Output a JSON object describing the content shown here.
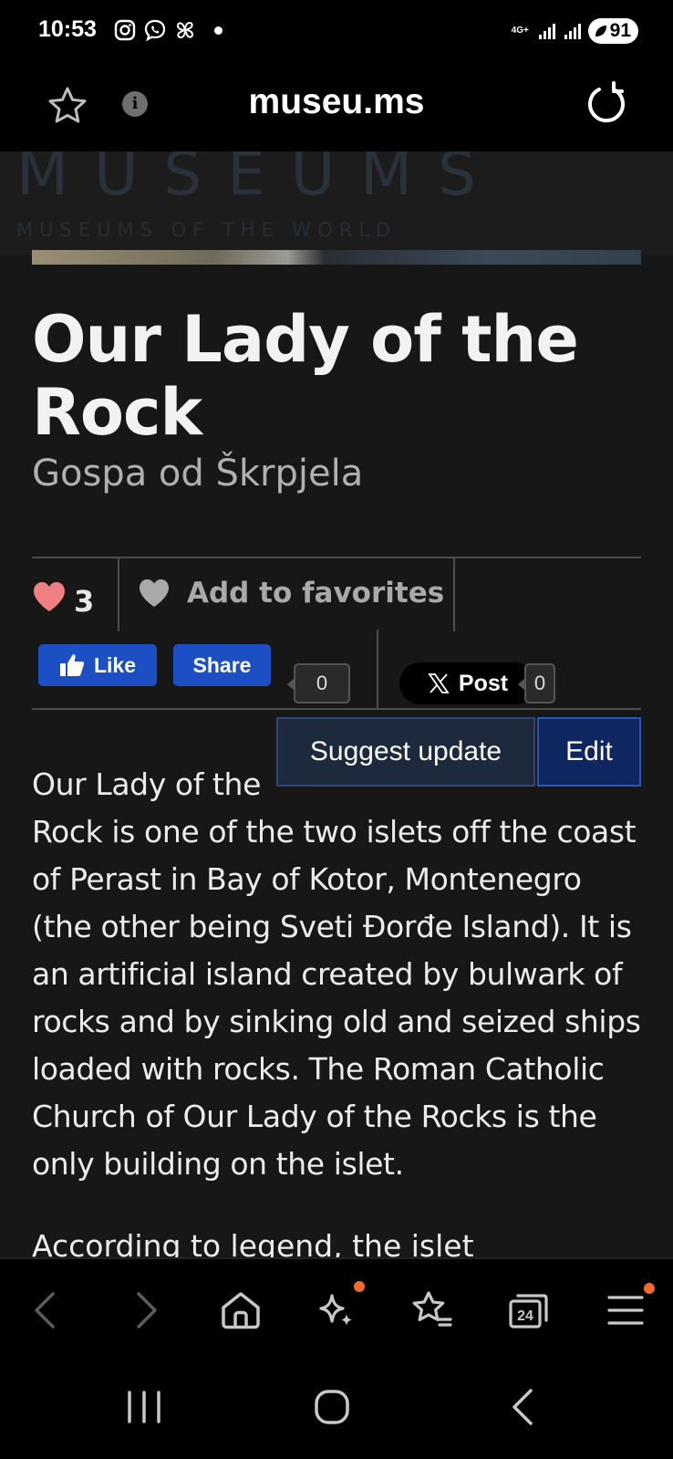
{
  "status": {
    "time": "10:53",
    "network_label": "4G+",
    "battery": "91",
    "left_icons": [
      "instagram-icon",
      "viber-icon",
      "pinwheel-icon",
      "notification-dot"
    ],
    "right_icons": [
      "signal-icon",
      "signal-icon",
      "battery-icon"
    ]
  },
  "browser": {
    "url": "museu.ms"
  },
  "site": {
    "logo_title": "MUSEUMS",
    "logo_subtitle": "MUSEUMS OF THE WORLD"
  },
  "article": {
    "title": "Our Lady of the Rock",
    "subtitle": "Gospa od Škrpjela",
    "likes_count": "3",
    "add_favorites_label": "Add to favorites",
    "fb_like_label": "Like",
    "fb_share_label": "Share",
    "fb_count": "0",
    "x_post_label": "Post",
    "x_count": "0",
    "suggest_update_label": "Suggest update",
    "edit_label": "Edit",
    "body_first_line": "Our Lady of the",
    "body_rest": "Rock is one of the two islets off the coast of Perast in Bay of Kotor, Montenegro (the other being Sveti Đorđe Island). It is an artificial island created by bulwark of rocks and by sinking old and seized ships loaded with rocks. The Roman Catholic Church of Our Lady of the Rocks is the only building on the islet.",
    "body_cut_line": "According to legend, the islet"
  },
  "toolbar": {
    "tabs_count": "24",
    "badge_color": "#f26b2a"
  },
  "colors": {
    "heart_active": "#f08080",
    "facebook_blue": "#1d4fc4",
    "edit_blue": "#102660"
  }
}
